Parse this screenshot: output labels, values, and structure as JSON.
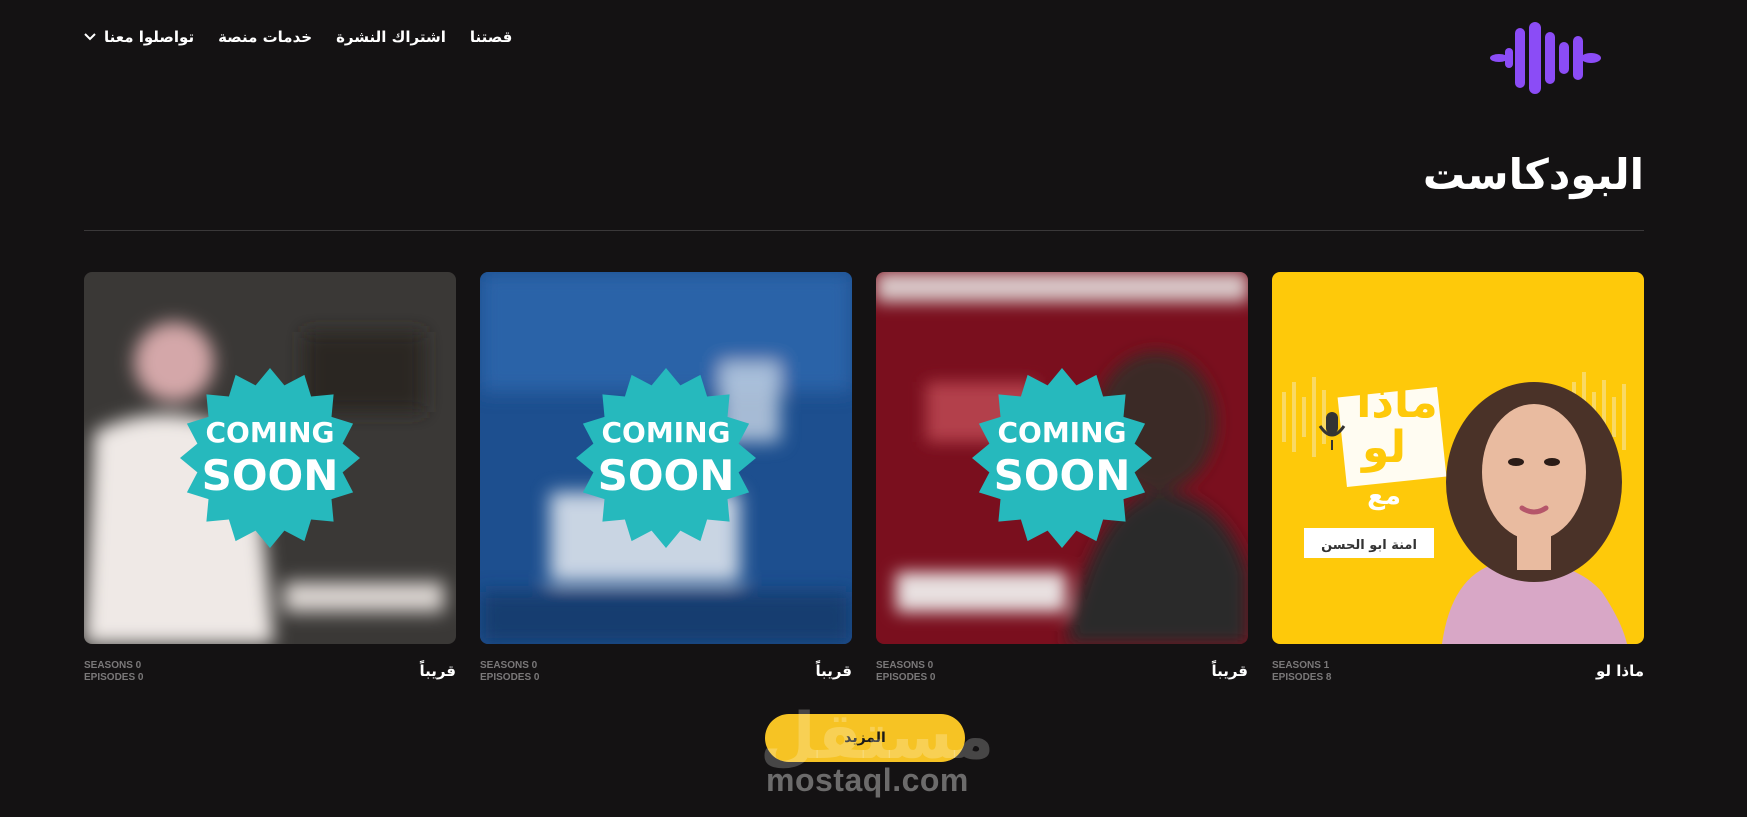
{
  "brand": {
    "accent": "#8b4cf6",
    "button_yellow": "#f6c324"
  },
  "nav": {
    "items": [
      "قصتنا",
      "اشتراك النشرة",
      "خدمات منصة"
    ],
    "contact_label": "تواصلوا معنا"
  },
  "page_title": "البودكاست",
  "podcasts": [
    {
      "title": "ماذا لو",
      "seasons": "SEASONS 1",
      "episodes": "EPISODES 8",
      "cover": {
        "bg": "#fec90a",
        "show_title": "ماذا لو",
        "with": "مع",
        "host": "امنة ابو الحسن"
      }
    },
    {
      "title": "قريباً",
      "seasons": "SEASONS 0",
      "episodes": "EPISODES 0",
      "cover": {
        "bg": "#7a0f1e",
        "badge_line1": "COMING",
        "badge_line2": "SOON"
      }
    },
    {
      "title": "قريباً",
      "seasons": "SEASONS 0",
      "episodes": "EPISODES 0",
      "cover": {
        "bg": "#1d4f8f",
        "badge_line1": "COMING",
        "badge_line2": "SOON"
      }
    },
    {
      "title": "قريباً",
      "seasons": "SEASONS 0",
      "episodes": "EPISODES 0",
      "cover": {
        "bg": "#3a3836",
        "badge_line1": "COMING",
        "badge_line2": "SOON"
      }
    }
  ],
  "more_button": "المزيد",
  "watermark": {
    "arabic": "مستقل",
    "latin": "mostaql.com"
  }
}
